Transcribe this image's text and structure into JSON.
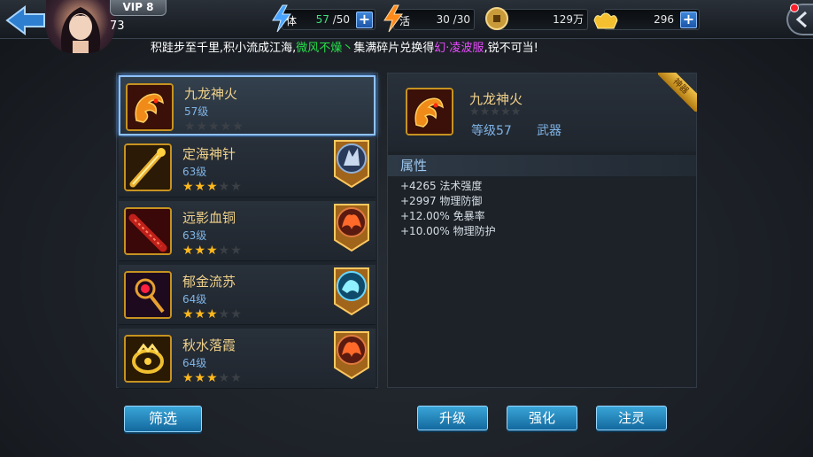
{
  "header": {
    "vip": "VIP 8",
    "level": "73",
    "stamina": {
      "label": "体",
      "current": "57",
      "max": "/50"
    },
    "vitality": {
      "label": "活",
      "value": "30 /30"
    },
    "coins": "129万",
    "ingots": "296",
    "plus": "+"
  },
  "ticker": {
    "part1": "积跬步至千里,积小流成江海,",
    "part2": "微风不燥丶",
    "part3": "集满碎片兑换得",
    "part4": "幻·凌波服",
    "part5": ",锐不可当!"
  },
  "items": [
    {
      "name": "九龙神火",
      "level": "57级",
      "stars": 0,
      "badge": ""
    },
    {
      "name": "定海神针",
      "level": "63级",
      "stars": 3,
      "badge": "wolf"
    },
    {
      "name": "远影血铜",
      "level": "63级",
      "stars": 3,
      "badge": "phoenix"
    },
    {
      "name": "郁金流苏",
      "level": "64级",
      "stars": 3,
      "badge": "dragon"
    },
    {
      "name": "秋水落霞",
      "level": "64级",
      "stars": 3,
      "badge": "phoenix"
    }
  ],
  "filter_label": "筛选",
  "detail": {
    "name": "九龙神火",
    "level": "等级57",
    "type": "武器",
    "ribbon": "神器",
    "attr_title": "属性",
    "attrs": [
      "+4265 法术强度",
      "+2997 物理防御",
      "+12.00% 免暴率",
      "+10.00% 物理防护"
    ]
  },
  "actions": {
    "upgrade": "升级",
    "enhance": "强化",
    "infuse": "注灵"
  }
}
